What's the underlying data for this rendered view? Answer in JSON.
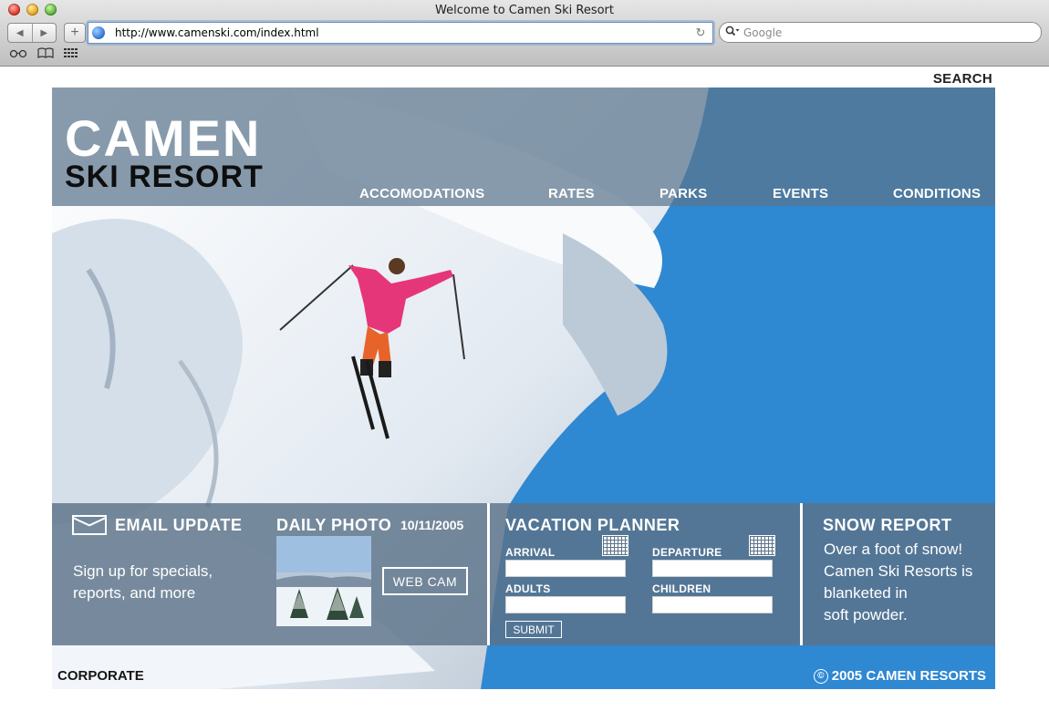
{
  "browser": {
    "window_title": "Welcome to Camen Ski Resort",
    "url": "http://www.camenski.com/index.html",
    "search_placeholder": "Google",
    "nav_back_glyph": "◀",
    "nav_forward_glyph": "▶",
    "add_glyph": "+",
    "reload_glyph": "↻",
    "search_glyph": "🔍▾",
    "bookmark_glasses_glyph": "👓",
    "bookmark_book_glyph": "📖",
    "icons": [
      "back-arrow-icon",
      "forward-arrow-icon",
      "plus-icon",
      "globe-icon",
      "reload-icon",
      "magnifier-icon",
      "glasses-icon",
      "book-icon",
      "grid-icon"
    ]
  },
  "page": {
    "search_label": "SEARCH",
    "logo_top": "CAMEN",
    "logo_bottom": "SKI RESORT",
    "nav": [
      "ACCOMODATIONS",
      "RATES",
      "PARKS",
      "EVENTS",
      "CONDITIONS"
    ]
  },
  "email_update": {
    "heading": "EMAIL UPDATE",
    "line1": "Sign up for specials,",
    "line2": "reports, and more"
  },
  "daily_photo": {
    "heading": "DAILY PHOTO",
    "date": "10/11/2005",
    "webcam_label": "WEB CAM"
  },
  "vacation_planner": {
    "heading": "VACATION PLANNER",
    "arrival_label": "ARRIVAL",
    "departure_label": "DEPARTURE",
    "adults_label": "ADULTS",
    "children_label": "CHILDREN",
    "arrival_value": "",
    "departure_value": "",
    "adults_value": "",
    "children_value": "",
    "submit_label": "SUBMIT"
  },
  "snow_report": {
    "heading": "SNOW REPORT",
    "lines": [
      "Over a foot of snow!",
      "Camen Ski Resorts is",
      "blanketed in",
      "soft powder."
    ]
  },
  "footer": {
    "corporate": "CORPORATE",
    "copyright_glyph": "©",
    "copyright": "2005 CAMEN RESORTS"
  },
  "colors": {
    "panel": "#5c7389",
    "sky": "#2d86d0",
    "header_band": "#5a748c"
  }
}
